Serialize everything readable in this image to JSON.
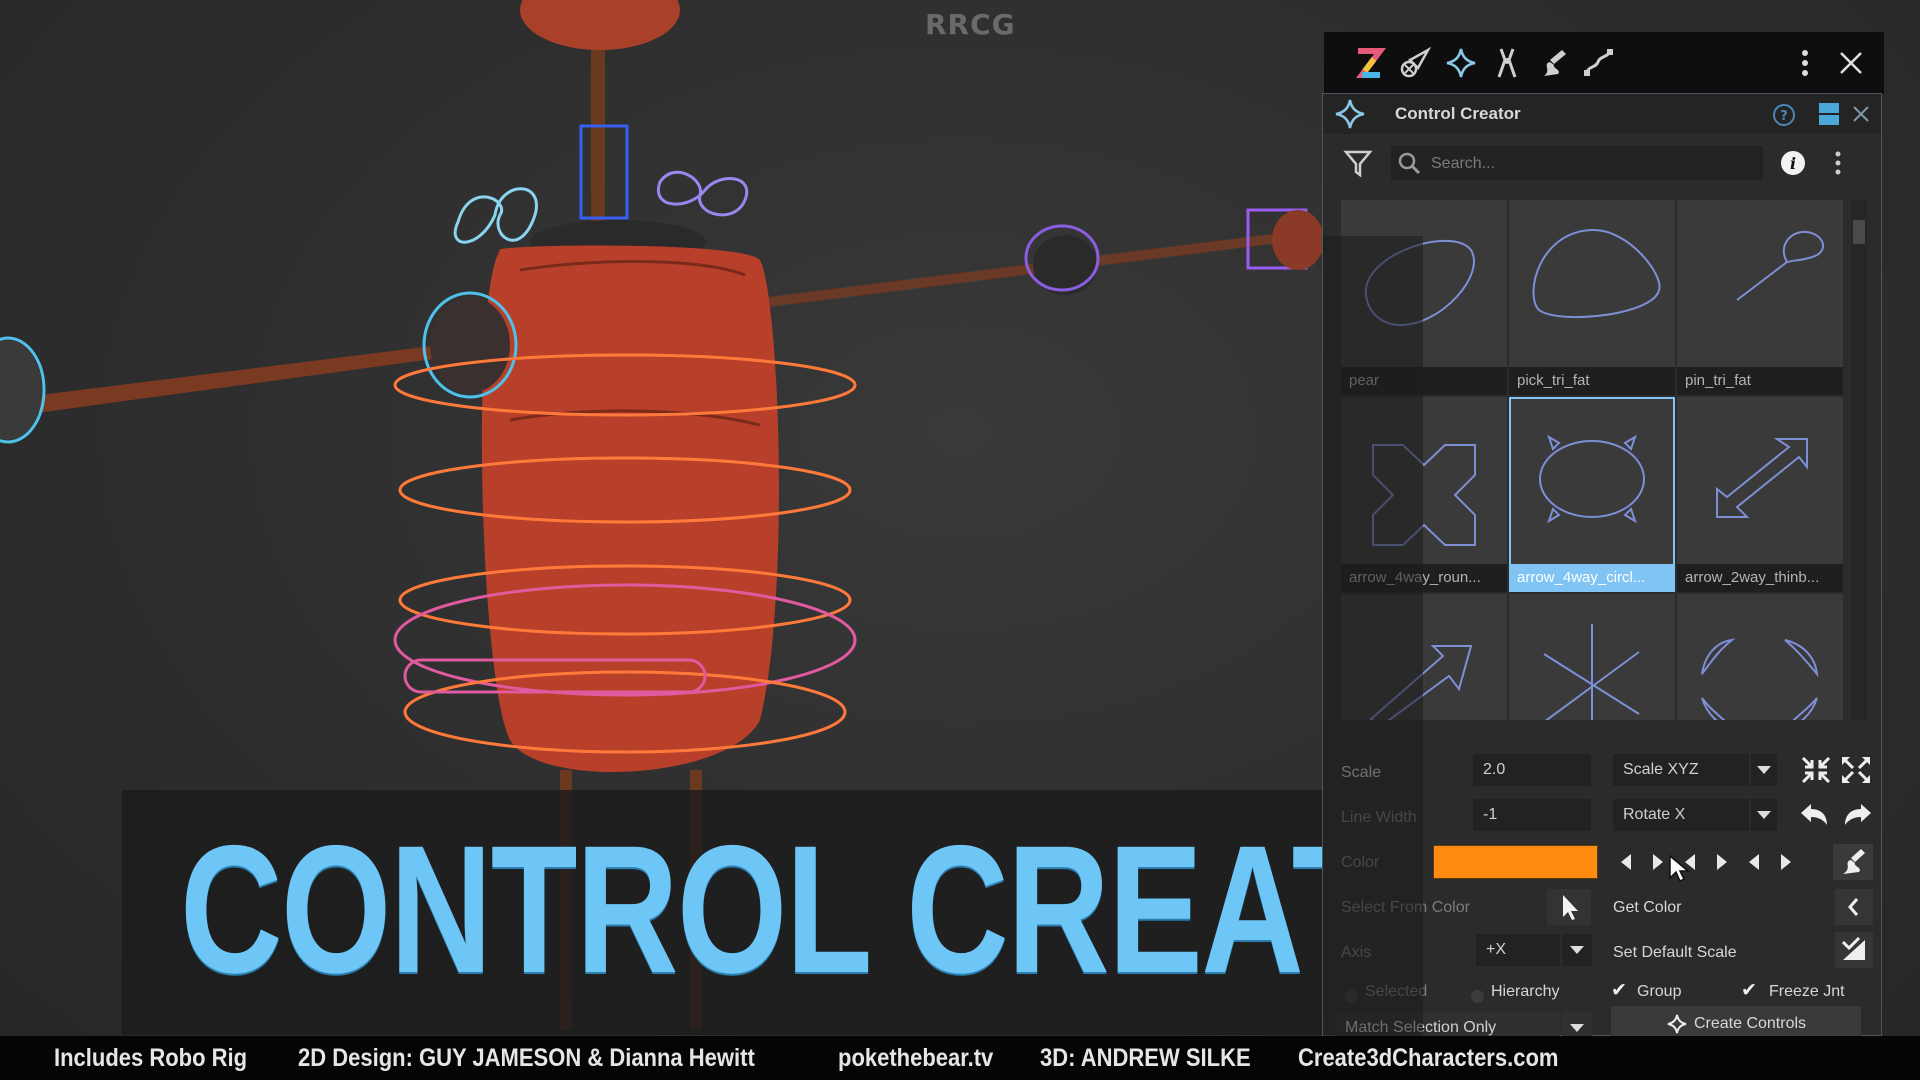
{
  "watermark": "RRCG",
  "overlay_title": "CONTROL CREATOR",
  "credits": {
    "includes": "Includes Robo Rig",
    "design": "2D Design:  GUY JAMESON & Dianna Hewitt",
    "site1": "pokethebear.tv",
    "modeling": "3D:  ANDREW SILKE",
    "site2": "Create3dCharacters.com"
  },
  "toolbar": {
    "icons": [
      "z-logo-icon",
      "rocket-icon",
      "star-sparkle-icon",
      "pliers-icon",
      "brush-icon",
      "curve-icon"
    ],
    "menu_icon": "kebab-menu-icon",
    "close_icon": "close-icon"
  },
  "panel": {
    "title": "Control Creator",
    "header_icons": [
      "help-icon",
      "layout-icon",
      "close-icon"
    ],
    "search": {
      "placeholder": "Search...",
      "value": ""
    },
    "info_icon": "info-icon",
    "grid": [
      {
        "label": "pear",
        "shape": "pear",
        "selected": false
      },
      {
        "label": "pick_tri_fat",
        "shape": "pick_tri",
        "selected": false
      },
      {
        "label": "pin_tri_fat",
        "shape": "pin_tri",
        "selected": false
      },
      {
        "label": "arrow_4way_roun...",
        "shape": "arrow_4way_round",
        "selected": false
      },
      {
        "label": "arrow_4way_circl...",
        "shape": "arrow_4way_circle",
        "selected": true
      },
      {
        "label": "arrow_2way_thinb...",
        "shape": "arrow_2way",
        "selected": false
      },
      {
        "label": "",
        "shape": "arrow_1way",
        "selected": false
      },
      {
        "label": "",
        "shape": "star_lines",
        "selected": false
      },
      {
        "label": "",
        "shape": "circle_segments",
        "selected": false
      }
    ],
    "settings": {
      "scale_label": "Scale",
      "scale_value": "2.0",
      "scale_mode": "Scale XYZ",
      "line_width_label": "Line Width",
      "line_width_value": "-1",
      "rotate_mode": "Rotate X",
      "color_label": "Color",
      "color_value": "#ff8c11",
      "select_from_color_label": "Select From Color",
      "get_color_label": "Get Color",
      "axis_label": "Axis",
      "axis_value": "+X",
      "set_default_scale_label": "Set Default Scale",
      "selected_label": "Selected",
      "hierarchy_label": "Hierarchy",
      "group_label": "Group",
      "group_checked": true,
      "freeze_label": "Freeze Jnt",
      "freeze_checked": true,
      "match_mode": "Match Selection Only",
      "create_label": "Create Controls"
    }
  },
  "colors": {
    "accent": "#7fc4f2",
    "title_blue": "#6ec6f6",
    "swatch": "#ff8c11",
    "curve_blue": "#7e8fd6"
  }
}
